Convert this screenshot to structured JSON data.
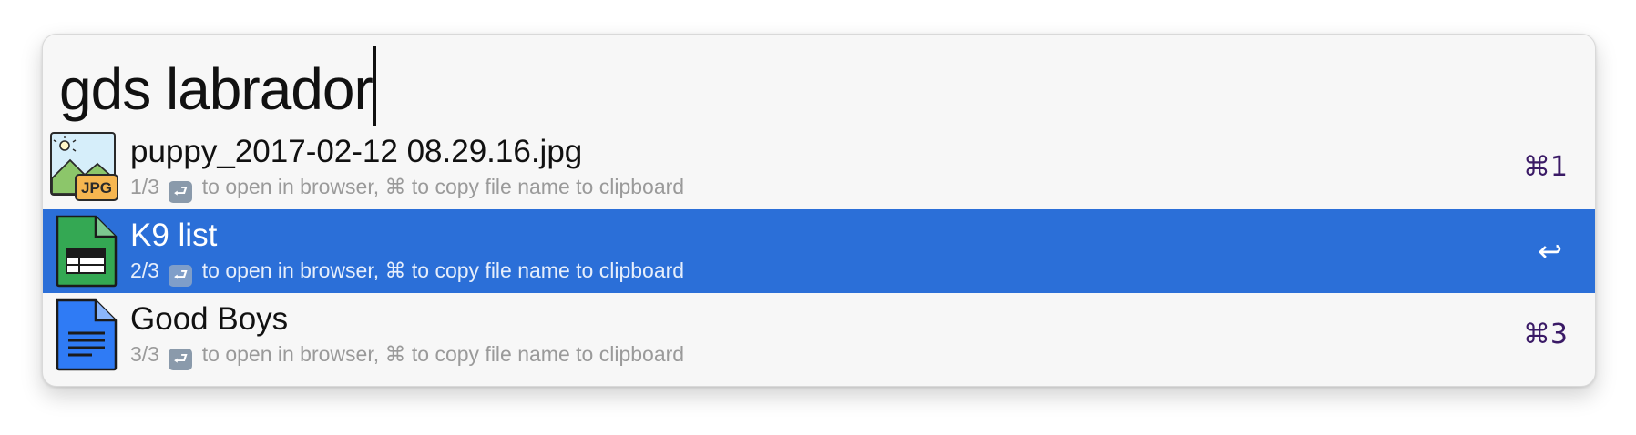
{
  "search": {
    "query": "gds labrador"
  },
  "results": [
    {
      "title": "puppy_2017-02-12 08.29.16.jpg",
      "position": "1/3",
      "enter_glyph": "⮐",
      "hint_open": "to open in browser,",
      "hint_cmd_glyph": "⌘",
      "hint_copy": "to copy file name to clipboard",
      "shortcut": "⌘1",
      "icon": "jpg-image-file-icon",
      "icon_label": "JPG"
    },
    {
      "title": "K9 list",
      "position": "2/3",
      "enter_glyph": "⮐",
      "hint_open": "to open in browser,",
      "hint_cmd_glyph": "⌘",
      "hint_copy": "to copy file name to clipboard",
      "shortcut": "↩",
      "icon": "spreadsheet-file-icon",
      "selected": true
    },
    {
      "title": "Good Boys",
      "position": "3/3",
      "enter_glyph": "⮐",
      "hint_open": "to open in browser,",
      "hint_cmd_glyph": "⌘",
      "hint_copy": "to copy file name to clipboard",
      "shortcut": "⌘3",
      "icon": "document-file-icon"
    }
  ],
  "colors": {
    "selection": "#2b6fd8",
    "shortcut_text": "#3a1a66",
    "subtext": "#9a9a9a",
    "sheets_green": "#34a853",
    "docs_blue": "#2f7bf5"
  }
}
